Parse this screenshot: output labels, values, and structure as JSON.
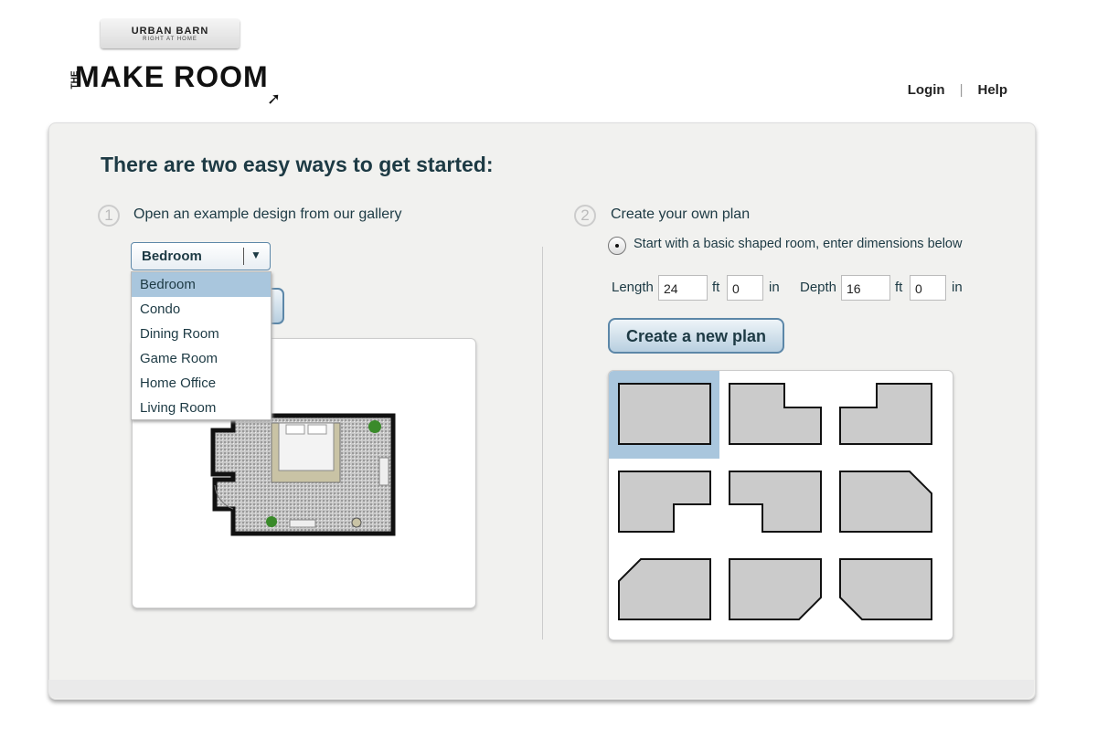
{
  "brand": {
    "name": "URBAN BARN",
    "tagline": "RIGHT AT HOME"
  },
  "logo": {
    "prefix": "THE",
    "title": "MAKE ROOM"
  },
  "nav": {
    "login": "Login",
    "separator": "|",
    "help": "Help"
  },
  "heading": "There are two easy ways to get started:",
  "option1": {
    "number": "1",
    "label": "Open an example design from our gallery",
    "select_value": "Bedroom",
    "options": [
      "Bedroom",
      "Condo",
      "Dining Room",
      "Game Room",
      "Home Office",
      "Living Room"
    ],
    "highlighted": "Bedroom"
  },
  "option2": {
    "number": "2",
    "label": "Create your own plan",
    "radio_label": "Start with a basic shaped room, enter dimensions below",
    "length_label": "Length",
    "length_ft": "24",
    "ft": "ft",
    "length_in": "0",
    "in": "in",
    "depth_label": "Depth",
    "depth_ft": "16",
    "depth_in": "0",
    "create_button": "Create a new plan",
    "shapes": [
      "rectangle",
      "notch-top-right",
      "notch-top-left",
      "notch-bottom-right",
      "notch-bottom-left",
      "cut-top-right",
      "cut-top-left",
      "cut-bottom-right",
      "cut-bottom-left"
    ],
    "selected_shape": "rectangle"
  },
  "colors": {
    "accent": "#5c87a8",
    "selection": "#a9c6dd",
    "text": "#1d3a44"
  }
}
